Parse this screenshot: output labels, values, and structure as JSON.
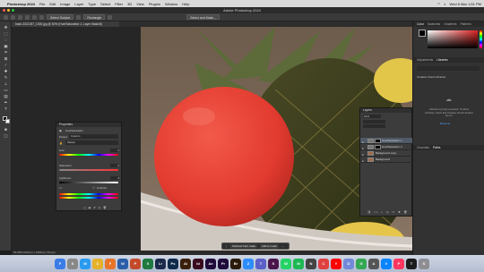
{
  "menubar": {
    "app_name": "Photoshop 2024",
    "items": [
      "File",
      "Edit",
      "Image",
      "Layer",
      "Type",
      "Select",
      "Filter",
      "3D",
      "View",
      "Plugins",
      "Window",
      "Help"
    ],
    "clock": "Wed 6 Mar  1:51 PM"
  },
  "window": {
    "title": "Adobe Photoshop 2024"
  },
  "options_bar": {
    "buttons": [
      "Select Subject",
      "Select and Mask..."
    ],
    "mode_label": "Rectangle"
  },
  "document": {
    "tab_title": "bash-3321257_1920.jpg @ 50% (Hue/Saturation 1, Layer Mask/8)",
    "status": "50.00%    1920 px x 1280 px (72 ppi)"
  },
  "properties": {
    "title": "Properties",
    "adjustment": "Hue/Saturation",
    "preset_label": "Preset:",
    "preset_value": "Custom",
    "channel_value": "Master",
    "hue_label": "Hue:",
    "hue_value": "0",
    "saturation_label": "Saturation:",
    "saturation_value": "0",
    "lightness_label": "Lightness:",
    "lightness_value": "0",
    "colorize_label": "Colorize"
  },
  "layers": {
    "title": "Layers",
    "kind_label": "Kind",
    "rows": [
      {
        "name": "Hue/Saturation 1",
        "selected": true
      },
      {
        "name": "Hue/Saturation 2",
        "selected": false
      },
      {
        "name": "Background copy",
        "selected": false
      },
      {
        "name": "Background",
        "selected": false
      }
    ]
  },
  "right_panel": {
    "tabs_top": [
      "Color",
      "Swatches",
      "Gradients",
      "Patterns"
    ],
    "tabs_mid": [
      "Adjustments",
      "Libraries"
    ],
    "library_name": "Creative Cloud Libraries",
    "empty_text": "Libraries syncing is paused. To follow Libraries, check that Creative Cloud Libraries are on.",
    "resume": "Resume",
    "tabs_bottom": [
      "Channels",
      "Paths"
    ]
  },
  "context_bar": {
    "buttons": [
      "Subtract front mask",
      "Add to mask"
    ]
  },
  "dock": {
    "icons": [
      {
        "label": "F",
        "color": "#3b7de8"
      },
      {
        "label": "S",
        "color": "#888888"
      },
      {
        "label": "M",
        "color": "#2a9af0"
      },
      {
        "label": "C",
        "color": "#e6b12a"
      },
      {
        "label": "F",
        "color": "#e8742a"
      },
      {
        "label": "W",
        "color": "#2b5ea8"
      },
      {
        "label": "P",
        "color": "#c44b2a"
      },
      {
        "label": "X",
        "color": "#1f7a3f"
      },
      {
        "label": "Lr",
        "color": "#1b2a4a"
      },
      {
        "label": "Ps",
        "color": "#0f2a4a"
      },
      {
        "label": "Ai",
        "color": "#3a1f0a"
      },
      {
        "label": "Id",
        "color": "#3a0a1f"
      },
      {
        "label": "Ae",
        "color": "#1f0a3a"
      },
      {
        "label": "Pr",
        "color": "#1f0a3a"
      },
      {
        "label": "Br",
        "color": "#2a1a0a"
      },
      {
        "label": "Z",
        "color": "#2d8cff"
      },
      {
        "label": "T",
        "color": "#5b5fc7"
      },
      {
        "label": "S",
        "color": "#4a154b"
      },
      {
        "label": "W",
        "color": "#25d366"
      },
      {
        "label": "M",
        "color": "#1db954"
      },
      {
        "label": "N",
        "color": "#444444"
      },
      {
        "label": "C",
        "color": "#e04040"
      },
      {
        "label": "Y",
        "color": "#ff0000"
      },
      {
        "label": "D",
        "color": "#7289da"
      },
      {
        "label": "G",
        "color": "#34a853"
      },
      {
        "label": "A",
        "color": "#555555"
      },
      {
        "label": "V",
        "color": "#0a84ff"
      },
      {
        "label": "P",
        "color": "#ff375f"
      },
      {
        "label": "T",
        "color": "#1c1c1e"
      },
      {
        "label": "S",
        "color": "#8e8e93"
      }
    ]
  }
}
